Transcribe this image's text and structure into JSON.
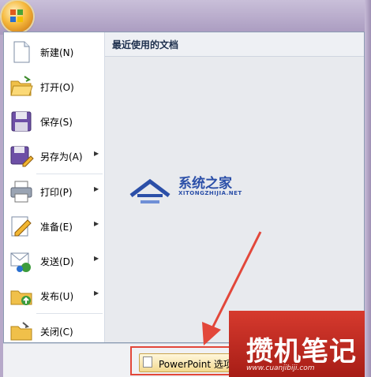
{
  "menu": {
    "recent_title": "最近使用的文档",
    "items": [
      {
        "label": "新建(N)",
        "icon": "new-document-icon",
        "submenu": false
      },
      {
        "label": "打开(O)",
        "icon": "open-folder-icon",
        "submenu": false
      },
      {
        "label": "保存(S)",
        "icon": "save-floppy-icon",
        "submenu": false
      },
      {
        "label": "另存为(A)",
        "icon": "save-as-icon",
        "submenu": true
      },
      {
        "label": "打印(P)",
        "icon": "printer-icon",
        "submenu": true
      },
      {
        "label": "准备(E)",
        "icon": "prepare-pencil-icon",
        "submenu": true
      },
      {
        "label": "发送(D)",
        "icon": "send-icon",
        "submenu": true
      },
      {
        "label": "发布(U)",
        "icon": "publish-icon",
        "submenu": true
      },
      {
        "label": "关闭(C)",
        "icon": "close-document-icon",
        "submenu": false
      }
    ]
  },
  "footer": {
    "options_label": "PowerPoint 选项"
  },
  "watermark": {
    "cn": "系统之家",
    "en": "XITONGZHIJIA.NET"
  },
  "badge": {
    "text": "攒机笔记",
    "url": "www.cuanjibiji.com"
  },
  "colors": {
    "highlight": "#e2473a",
    "badge": "#c0261d",
    "watermark": "#2b4fa8"
  }
}
